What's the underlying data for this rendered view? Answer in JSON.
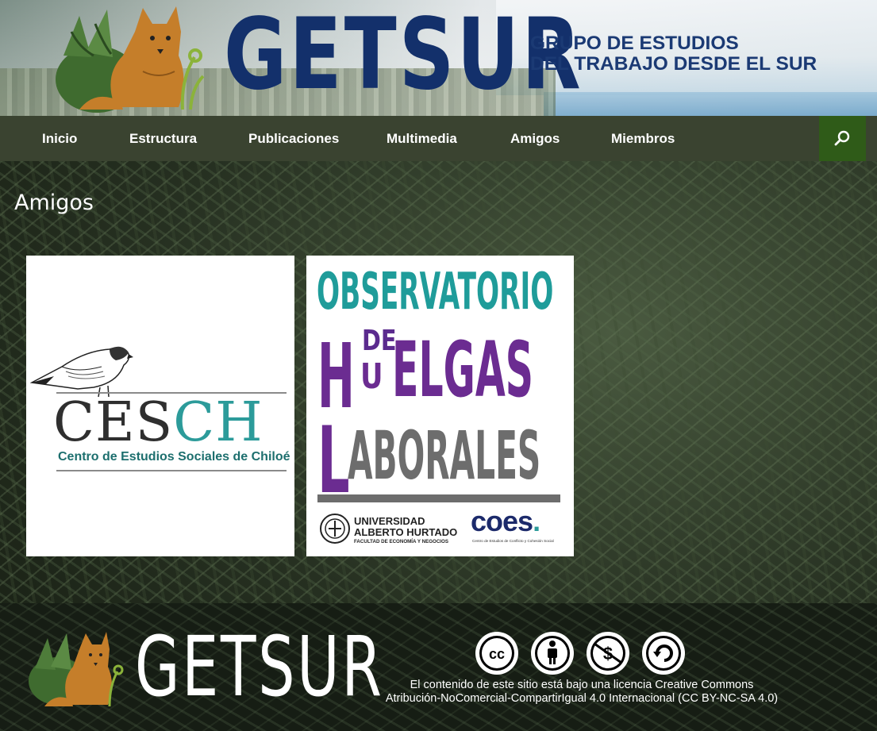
{
  "header": {
    "brand": "GETSUR",
    "subtitle_line1": "GRUPO DE ESTUDIOS",
    "subtitle_line2": "DEL TRABAJO DESDE EL SUR",
    "logo_icon": "fox-with-plants-logo"
  },
  "nav": {
    "items": [
      {
        "label": "Inicio"
      },
      {
        "label": "Estructura"
      },
      {
        "label": "Publicaciones"
      },
      {
        "label": "Multimedia"
      },
      {
        "label": "Amigos"
      },
      {
        "label": "Miembros"
      }
    ],
    "search_icon": "search-icon"
  },
  "main": {
    "title": "Amigos",
    "partners": [
      {
        "name": "CESCH",
        "word_dark": "CES",
        "word_teal": "CH",
        "subtitle": "Centro de Estudios Sociales de Chiloé",
        "icon": "bird-illustration"
      },
      {
        "name": "Observatorio de Huelgas Laborales",
        "line1": "OBSERVATORIO",
        "de": "DE",
        "h": "H",
        "u": "U",
        "elgas": "ELGAS",
        "l": "L",
        "aborales": "ABORALES",
        "uah_line1": "UNIVERSIDAD",
        "uah_line2": "ALBERTO HURTADO",
        "uah_line3": "FACULTAD DE ECONOMÍA Y NEGOCIOS",
        "coes": "coes",
        "coes_dot": ".",
        "coes_sub": "Centro de Estudios de Conflicto y Cohesión Social"
      }
    ]
  },
  "footer": {
    "brand": "GETSUR",
    "license_line1": "El contenido de este sitio está bajo una licencia Creative Commons",
    "license_line2": "Atribución-NoComercial-CompartirIgual 4.0 Internacional (CC BY-NC-SA 4.0)",
    "cc_icons": [
      "cc-icon",
      "by-icon",
      "nc-icon",
      "sa-icon"
    ]
  },
  "colors": {
    "nav_bg": "#3a4330",
    "search_bg": "#2f5b18",
    "brand_blue": "#13306b",
    "teal": "#1f9c9a",
    "purple": "#6b2c91"
  }
}
